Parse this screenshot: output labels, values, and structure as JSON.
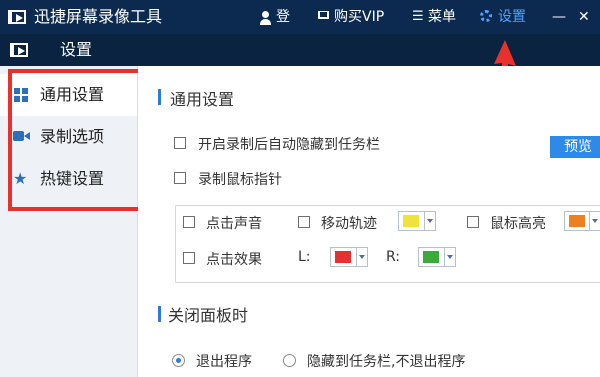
{
  "app": {
    "title": "迅捷屏幕录像工具",
    "login_label": "登录",
    "buy_label": "购买VIP",
    "menu_label": "菜单",
    "settings_label": "设置",
    "menu_glyph": "☰",
    "minimize_glyph": "—",
    "close_glyph": "✕"
  },
  "window": {
    "title": "设置"
  },
  "sidebar": {
    "items": [
      {
        "label": "通用设置",
        "icon": "grid-icon",
        "selected": true
      },
      {
        "label": "录制选项",
        "icon": "video-camera-icon",
        "selected": false
      },
      {
        "label": "热键设置",
        "icon": "star-icon",
        "selected": false
      }
    ]
  },
  "general": {
    "title": "通用设置",
    "hide_on_record": "开启录制后自动隐藏到任务栏",
    "preview_button": "预览",
    "record_cursor": "录制鼠标指针",
    "click_sound": "点击声音",
    "move_track": "移动轨迹",
    "cursor_highlight": "鼠标高亮",
    "click_effect": "点击效果",
    "left_label": "L:",
    "right_label": "R:"
  },
  "colors": {
    "move_track": "#f0e23a",
    "cursor_highlight": "#f07f20",
    "left_click": "#e83030",
    "right_click": "#3aab3a",
    "annotation": "#e8302c",
    "topbar": "#0c2a4f",
    "accent": "#2d7bd8"
  },
  "close_panel": {
    "title": "关闭面板时",
    "exit_option": "退出程序",
    "hide_option": "隐藏到任务栏,不退出程序",
    "selected": "exit"
  }
}
